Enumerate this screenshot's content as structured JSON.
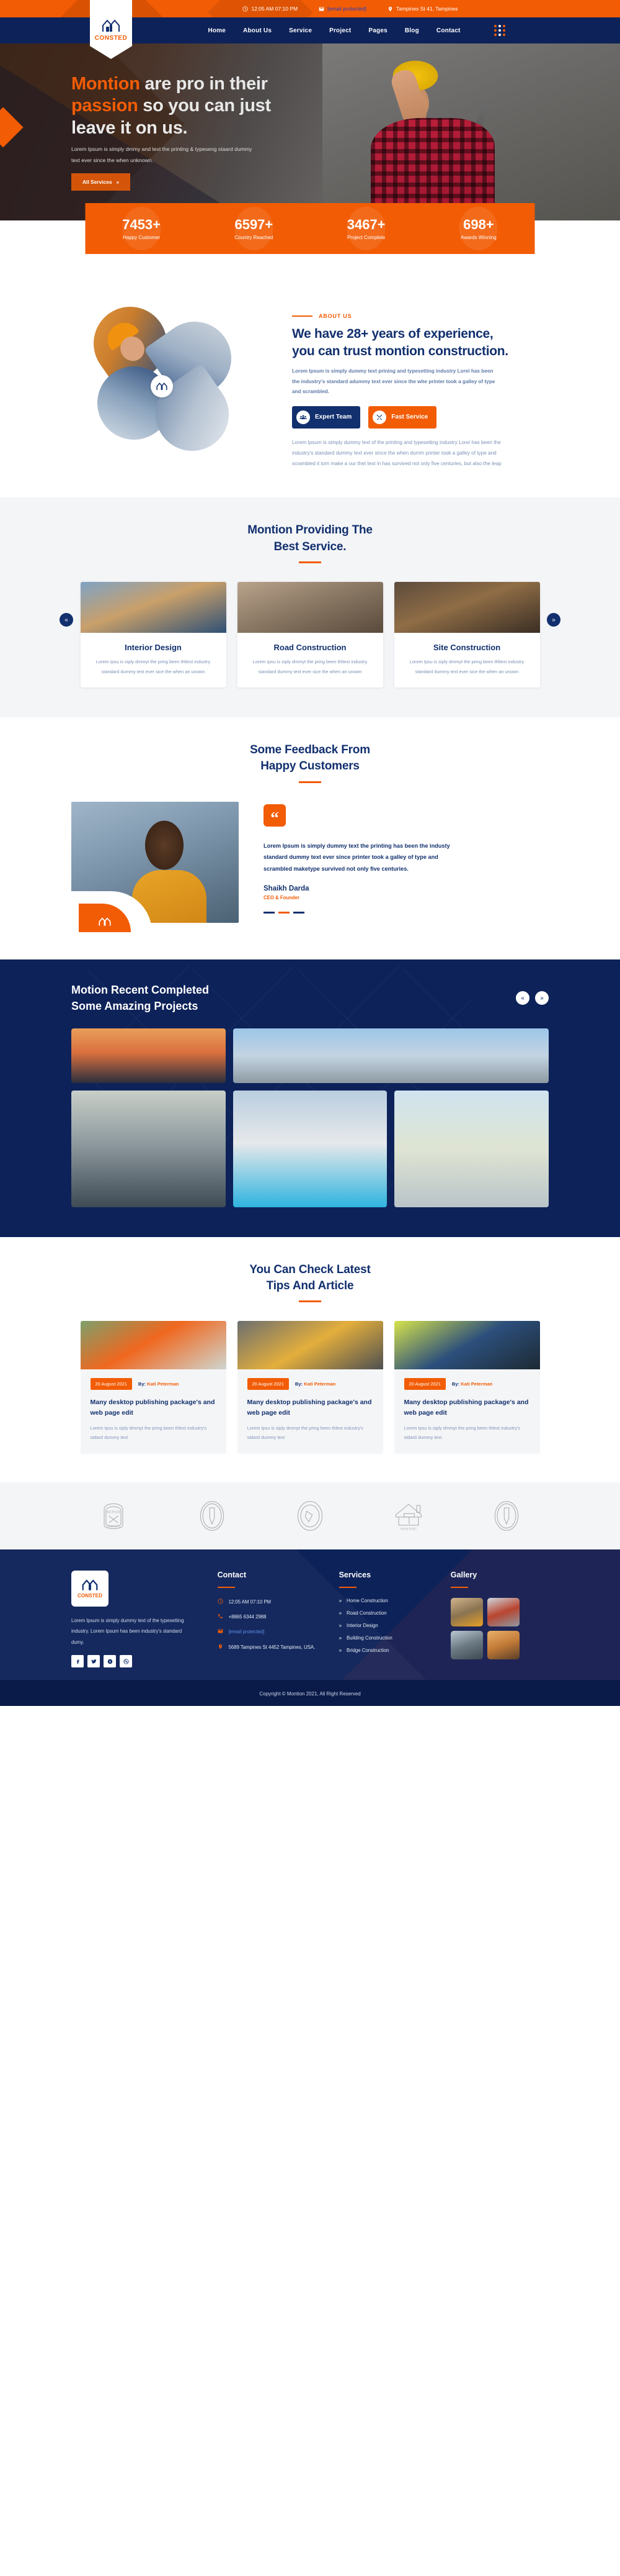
{
  "brand": {
    "name": "CONSTED",
    "logo_icon": "house-twin-icon"
  },
  "topbar": {
    "items": [
      {
        "icon": "clock-icon",
        "text": "12:05 AM 07:10 PM",
        "style": "plain"
      },
      {
        "icon": "mail-icon",
        "text": "[email protected]",
        "style": "mail"
      },
      {
        "icon": "location-pin-icon",
        "text": "Tampines St 41, Tampines",
        "style": "plain"
      }
    ]
  },
  "nav": {
    "links": [
      "Home",
      "About Us",
      "Service",
      "Project",
      "Pages",
      "Blog",
      "Contact"
    ],
    "grid_icon": "grid-dots-icon"
  },
  "hero": {
    "title_part1": "Montion",
    "title_part2": " are pro in their ",
    "title_part3": "passion",
    "title_part4": " so you can just leave it on us.",
    "paragraph": "Lorem Ipsum is simply dmmy and text the printing & typeseng staard dummy text ever since the when unknown.",
    "cta": "All Services",
    "cta_icon": "double-chevron-right-icon"
  },
  "stats": [
    {
      "num": "7453+",
      "label": "Happy Customer"
    },
    {
      "num": "6597+",
      "label": "Country Reached"
    },
    {
      "num": "3467+",
      "label": "Project Complete"
    },
    {
      "num": "698+",
      "label": "Awards Winning"
    }
  ],
  "about": {
    "eyebrow": "ABOUT US",
    "heading": "We have 28+ years of experience, you can trust montion construction.",
    "lead": "Lorem Ipsum is simply dummy text prining and typesetting industry Lorei has been the industry's standard adummy text ever since the whe printer took a galley of type and scrambled.",
    "buttons": [
      {
        "label": "Expert Team",
        "icon": "team-icon",
        "color": "#12306e"
      },
      {
        "label": "Fast Service",
        "icon": "tools-icon",
        "color": "#f25c05"
      }
    ],
    "tail": "Lorem Ipsum is simply dummy text of the printing and typesetting industry Lorei has been the industry's standard dummy text ever since the when dumm printer took a galley of type and scrambled it tom make a our thet text in has survived not only five centuries, but also the leap"
  },
  "services": {
    "heading_line1": "Montion Providing The",
    "heading_line2": "Best Service.",
    "prev_icon": "chevron-left-icon",
    "next_icon": "chevron-right-icon",
    "cards": [
      {
        "title": "Interior Design",
        "text": "Lorem Ipsu is siply dmmyt the pring been thltext industry standard dummy text ever sice the when an unown"
      },
      {
        "title": "Road Construction",
        "text": "Lorem Ipsu is siply dmmyt the pring been thltext industry standard dummy text ever sice the when an unown"
      },
      {
        "title": "Site Construction",
        "text": "Lorem Ipsu is siply dmmyt the pring been thltext industry standard dummy text ever sice the when an unown"
      }
    ]
  },
  "testimonial": {
    "heading_line1": "Some Feedback From",
    "heading_line2": "Happy Customers",
    "quote_icon": "quote-icon",
    "quote": "Lorem Ipsum is simply dummy text the printing has been the industy standard dummy text ever since printer took a galley of type and scrambled maketype survived not only five centuries.",
    "name": "Shaikh Darda",
    "role": "CEO & Founder"
  },
  "projects": {
    "heading_line1": "Motion Recent Completed",
    "heading_line2": "Some Amazing Projects",
    "prev_icon": "chevron-left-icon",
    "next_icon": "chevron-right-icon",
    "images": [
      "bridge-sunset-photo",
      "steel-bridge-mountain-photo",
      "arch-bridge-water-photo",
      "modern-villa-pool-photo",
      "apartment-tower-photo"
    ]
  },
  "blog": {
    "heading_line1": "You Can Check Latest",
    "heading_line2": "Tips And Article",
    "posts": [
      {
        "date": "20 August 2021",
        "by_prefix": "By:",
        "author": "Kati Peterman",
        "title": "Many desktop publishing package's and web page edit",
        "excerpt": "Lorem Ipsu is siply dmmyt the pring been thlext industry's stdard dummy text"
      },
      {
        "date": "20 August 2021",
        "by_prefix": "By:",
        "author": "Kati Peterman",
        "title": "Many desktop publishing package's and web page edit",
        "excerpt": "Lorem Ipsu is siply dmmyt the pring been thlext industry's stdard dummy text"
      },
      {
        "date": "20 August 2021",
        "by_prefix": "By:",
        "author": "Kati Peterman",
        "title": "Many desktop publishing package's and web page edit",
        "excerpt": "Lorem Ipsu is siply dmmyt the pring been thlext industry's stdard dummy text"
      }
    ]
  },
  "partners": [
    {
      "name": "repair-service-badge",
      "label": "REPAIR SERVICE"
    },
    {
      "name": "under-construction-badge",
      "label": "UNDER CONSTRUCTION"
    },
    {
      "name": "installation-dismantling-badge",
      "label": "INSTALLATION DISMANTLING"
    },
    {
      "name": "painting-service-badge",
      "label": "PAINTING SERVICE"
    },
    {
      "name": "under-construction-badge-2",
      "label": "UNDER CONSTRUCTION"
    }
  ],
  "footer": {
    "about_text": "Lorem Ipsum is simply dummy text of the typesetting industry. Lorem Ipsum has been industry's standard dumy.",
    "socials": [
      "facebook-icon",
      "twitter-icon",
      "skype-icon",
      "dribbble-icon"
    ],
    "contact": {
      "title": "Contact",
      "items": [
        {
          "icon": "clock-icon",
          "text": "12:05 AM 07:10 PM",
          "style": "plain"
        },
        {
          "icon": "phone-icon",
          "text": "+8865 6344 2988",
          "style": "plain"
        },
        {
          "icon": "mail-icon",
          "text": "[email protected]",
          "style": "mail"
        },
        {
          "icon": "location-pin-icon",
          "text": "5689 Tampines St 4452 Tampines, USA.",
          "style": "plain"
        }
      ]
    },
    "services": {
      "title": "Services",
      "items": [
        "Home Construction",
        "Road Construction",
        "Interior Design",
        "Building Construction",
        "Bridge Construction"
      ]
    },
    "gallery": {
      "title": "Gallery",
      "images": [
        "excavator-site-photo",
        "red-building-photo",
        "machinery-photo",
        "crane-sunset-photo"
      ]
    },
    "copyright": "Copyright © Montion 2021, All Right Reserved"
  }
}
